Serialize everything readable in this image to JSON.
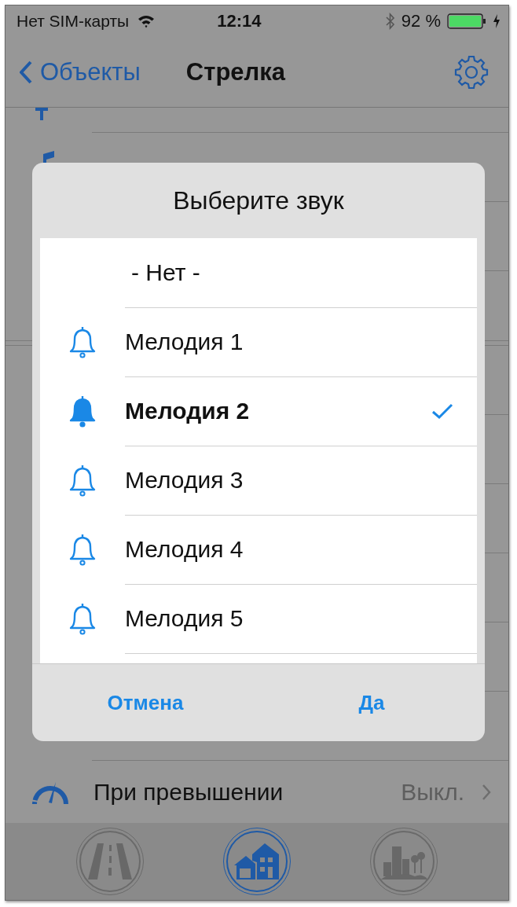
{
  "status_bar": {
    "carrier": "Нет SIM-карты",
    "time": "12:14",
    "battery": "92 %",
    "charging": true
  },
  "nav": {
    "back": "Объекты",
    "title": "Стрелка"
  },
  "list_rows": [
    {
      "label": "При превышении",
      "value": "Выкл."
    }
  ],
  "dialog": {
    "title": "Выберите звук",
    "options": [
      {
        "label": "- Нет -",
        "kind": "none",
        "selected": false
      },
      {
        "label": "Мелодия 1",
        "kind": "melody",
        "selected": false
      },
      {
        "label": "Мелодия 2",
        "kind": "melody",
        "selected": true
      },
      {
        "label": "Мелодия 3",
        "kind": "melody",
        "selected": false
      },
      {
        "label": "Мелодия 4",
        "kind": "melody",
        "selected": false
      },
      {
        "label": "Мелодия 5",
        "kind": "melody",
        "selected": false
      }
    ],
    "buttons": [
      "Отмена",
      "Да"
    ]
  },
  "tabs": [
    {
      "kind": "road",
      "selected": false
    },
    {
      "kind": "house",
      "selected": true
    },
    {
      "kind": "city",
      "selected": false
    }
  ]
}
